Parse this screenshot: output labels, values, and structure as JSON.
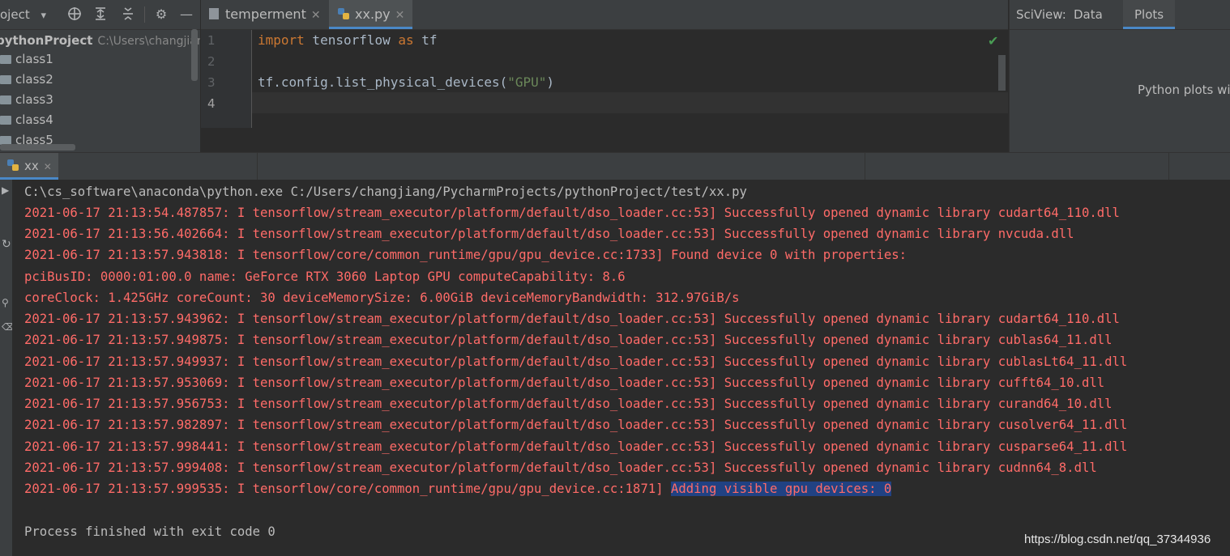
{
  "project": {
    "title": "oject",
    "root_name": "pythonProject",
    "root_path": "C:\\Users\\changjian",
    "items": [
      "class1",
      "class2",
      "class3",
      "class4",
      "class5"
    ]
  },
  "editor": {
    "tabs": [
      {
        "label": "temperment"
      },
      {
        "label": "xx.py"
      }
    ],
    "close_glyph": "✕",
    "line_numbers": [
      "1",
      "2",
      "3",
      "4"
    ],
    "code": {
      "line1_kw1": "import",
      "line1_mod": " tensorflow ",
      "line1_kw2": "as",
      "line1_alias": " tf",
      "line3_call": "tf.config.list_physical_devices(",
      "line3_str": "\"GPU\"",
      "line3_end": ")"
    }
  },
  "sciview": {
    "label": "SciView:",
    "tabs": [
      "Data",
      "Plots"
    ],
    "placeholder": "Python plots wil"
  },
  "run": {
    "tab_label": "xx",
    "command": "C:\\cs_software\\anaconda\\python.exe C:/Users/changjiang/PycharmProjects/pythonProject/test/xx.py",
    "lines": [
      "2021-06-17 21:13:54.487857: I tensorflow/stream_executor/platform/default/dso_loader.cc:53] Successfully opened dynamic library cudart64_110.dll",
      "2021-06-17 21:13:56.402664: I tensorflow/stream_executor/platform/default/dso_loader.cc:53] Successfully opened dynamic library nvcuda.dll",
      "2021-06-17 21:13:57.943818: I tensorflow/core/common_runtime/gpu/gpu_device.cc:1733] Found device 0 with properties:",
      "pciBusID: 0000:01:00.0 name: GeForce RTX 3060 Laptop GPU computeCapability: 8.6",
      "coreClock: 1.425GHz coreCount: 30 deviceMemorySize: 6.00GiB deviceMemoryBandwidth: 312.97GiB/s",
      "2021-06-17 21:13:57.943962: I tensorflow/stream_executor/platform/default/dso_loader.cc:53] Successfully opened dynamic library cudart64_110.dll",
      "2021-06-17 21:13:57.949875: I tensorflow/stream_executor/platform/default/dso_loader.cc:53] Successfully opened dynamic library cublas64_11.dll",
      "2021-06-17 21:13:57.949937: I tensorflow/stream_executor/platform/default/dso_loader.cc:53] Successfully opened dynamic library cublasLt64_11.dll",
      "2021-06-17 21:13:57.953069: I tensorflow/stream_executor/platform/default/dso_loader.cc:53] Successfully opened dynamic library cufft64_10.dll",
      "2021-06-17 21:13:57.956753: I tensorflow/stream_executor/platform/default/dso_loader.cc:53] Successfully opened dynamic library curand64_10.dll",
      "2021-06-17 21:13:57.982897: I tensorflow/stream_executor/platform/default/dso_loader.cc:53] Successfully opened dynamic library cusolver64_11.dll",
      "2021-06-17 21:13:57.998441: I tensorflow/stream_executor/platform/default/dso_loader.cc:53] Successfully opened dynamic library cusparse64_11.dll",
      "2021-06-17 21:13:57.999408: I tensorflow/stream_executor/platform/default/dso_loader.cc:53] Successfully opened dynamic library cudnn64_8.dll"
    ],
    "last_prefix": "2021-06-17 21:13:57.999535: I tensorflow/core/common_runtime/gpu/gpu_device.cc:1871] ",
    "last_selected": "Adding visible gpu devices: 0",
    "exit_message": "Process finished with exit code 0"
  },
  "watermark": "https://blog.csdn.net/qq_37344936",
  "colors": {
    "background": "#2b2b2b",
    "panel": "#3c3f41",
    "stderr_red": "#ff6b68",
    "keyword": "#cc7832",
    "string": "#6a8759",
    "selection": "#214283",
    "accent": "#4a88c7"
  }
}
